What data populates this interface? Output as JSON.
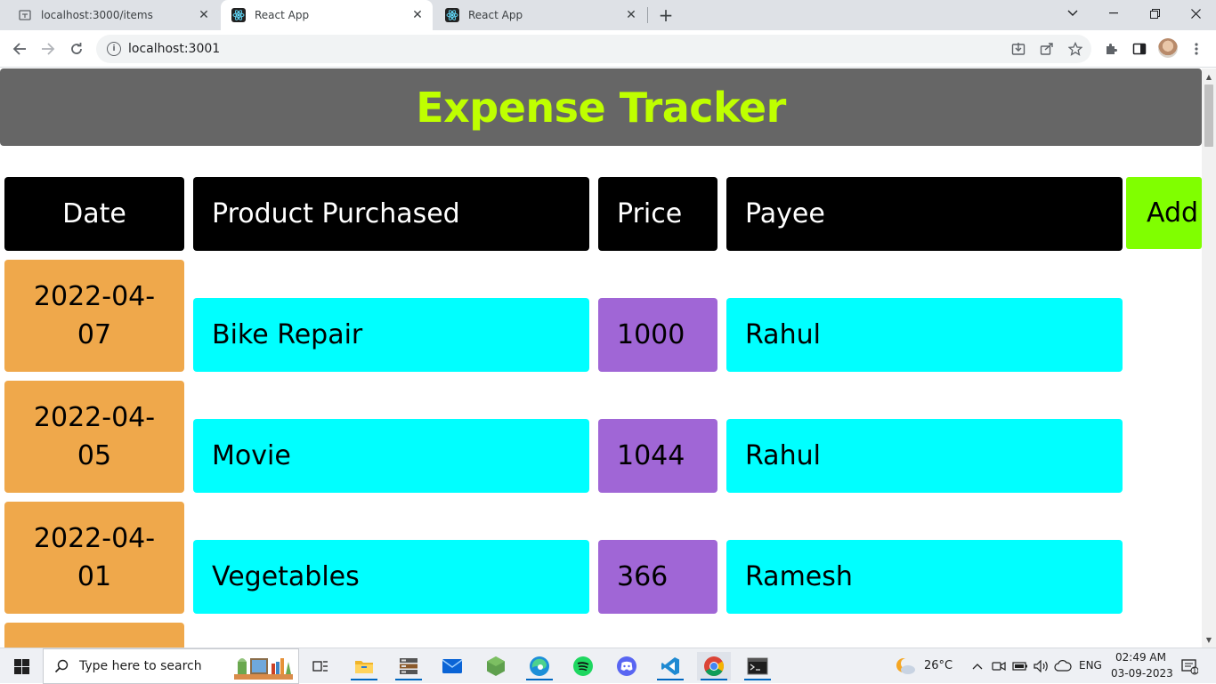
{
  "browser": {
    "tabs": [
      {
        "title": "localhost:3000/items",
        "active": false
      },
      {
        "title": "React App",
        "active": true
      },
      {
        "title": "React App",
        "active": false
      }
    ],
    "url": "localhost:3001"
  },
  "app": {
    "title": "Expense Tracker",
    "title_color": "#bfff00",
    "header_bg": "#666666",
    "columns": {
      "date": "Date",
      "product": "Product Purchased",
      "price": "Price",
      "payee": "Payee"
    },
    "add_label": "Add",
    "rows": [
      {
        "date_line1": "2022-04-",
        "date_line2": "07",
        "product": "Bike Repair",
        "price": "1000",
        "payee": "Rahul"
      },
      {
        "date_line1": "2022-04-",
        "date_line2": "05",
        "product": "Movie",
        "price": "1044",
        "payee": "Rahul"
      },
      {
        "date_line1": "2022-04-",
        "date_line2": "01",
        "product": "Vegetables",
        "price": "366",
        "payee": "Ramesh"
      }
    ],
    "colors": {
      "date_cell": "#efa84b",
      "text_cell": "#00ffff",
      "price_cell": "#a066d6",
      "add_button": "#80ff00"
    }
  },
  "taskbar": {
    "search_placeholder": "Type here to search",
    "weather": "26°C",
    "language": "ENG",
    "time": "02:49 AM",
    "date": "03-09-2023",
    "notification_count": "1",
    "apps": [
      "task-view",
      "file-explorer",
      "database-tool",
      "mail",
      "node",
      "edge",
      "spotify",
      "discord",
      "vscode",
      "chrome",
      "terminal"
    ]
  }
}
